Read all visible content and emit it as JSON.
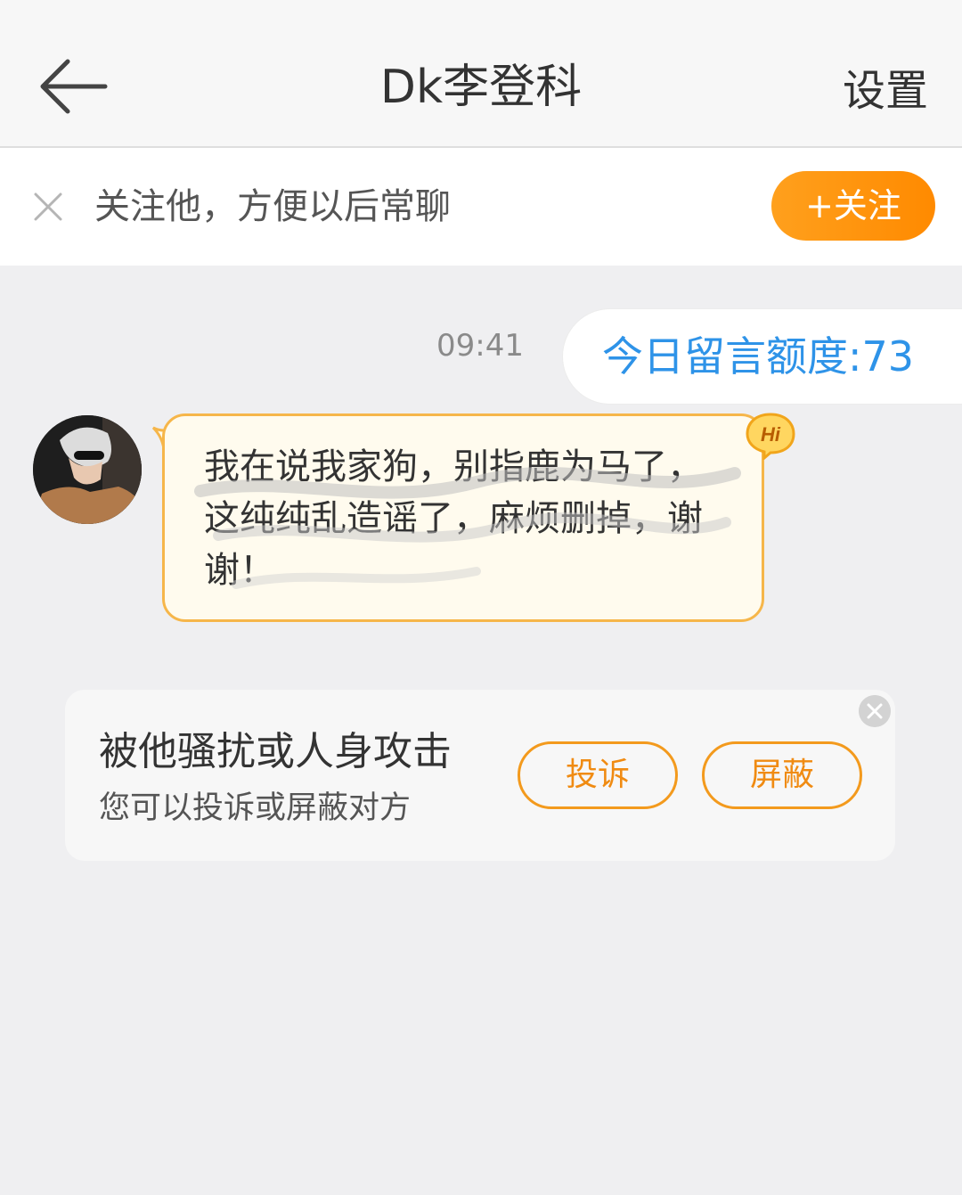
{
  "header": {
    "back_icon": "arrow-left-icon",
    "title": "Dk李登科",
    "settings_label": "设置"
  },
  "follow_bar": {
    "close_icon": "close-icon",
    "text": "关注他，方便以后常聊",
    "button_label": "+关注",
    "accent": "#ff8c00"
  },
  "chat": {
    "time": "09:41",
    "outgoing": {
      "text": "今日留言额度:73",
      "color": "#2e93e8"
    },
    "incoming": {
      "avatar_icon": "avatar-image",
      "badge": "Hi",
      "text": "我在说我家狗，别指鹿为马了，这纯纯乱造谣了，麻烦删掉，谢谢！"
    }
  },
  "report_card": {
    "title": "被他骚扰或人身攻击",
    "subtitle": "您可以投诉或屏蔽对方",
    "complain_label": "投诉",
    "block_label": "屏蔽",
    "close_icon": "close-circle-icon"
  }
}
